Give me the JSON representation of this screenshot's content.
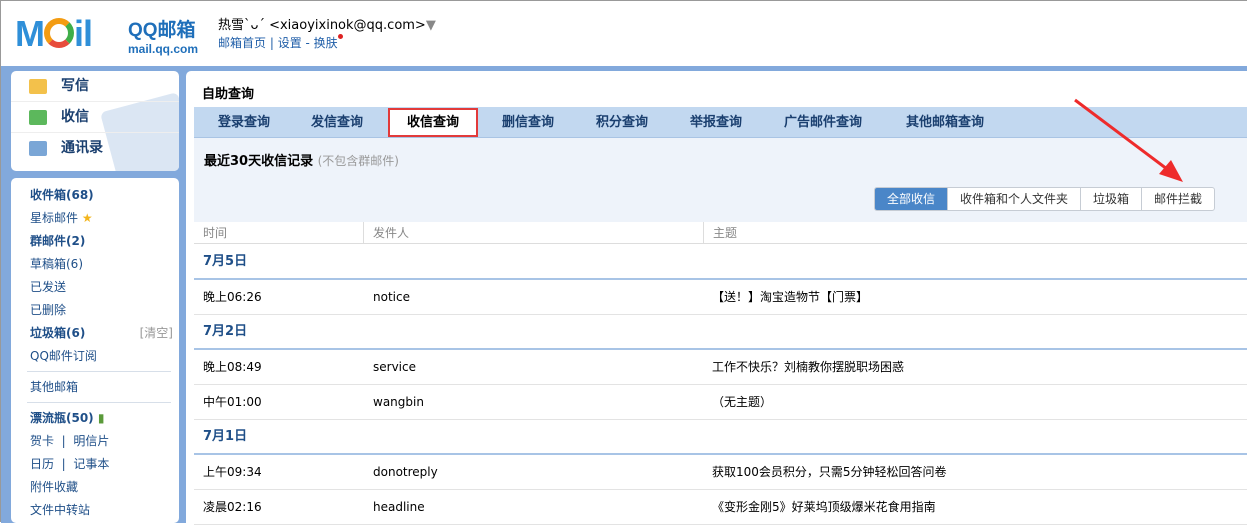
{
  "header": {
    "logo": "MOil",
    "brand": "QQ邮箱",
    "brand_url": "mail.qq.com",
    "user": "热雪`ᴗ´ <xiaoyixinok@qq.com>",
    "links": [
      "邮箱首页",
      "设置",
      "换肤"
    ]
  },
  "compose": [
    "写信",
    "收信",
    "通讯录"
  ],
  "folders": {
    "inbox": "收件箱(68)",
    "starred": "星标邮件",
    "group": "群邮件(2)",
    "drafts": "草稿箱(6)",
    "sent": "已发送",
    "deleted": "已删除",
    "spam": "垃圾箱(6)",
    "clear": "[清空]",
    "subscribe": "QQ邮件订阅",
    "other": "其他邮箱",
    "bottle": "漂流瓶(50)",
    "card": "贺卡",
    "postcard": "明信片",
    "calendar": "日历",
    "notes": "记事本",
    "attach": "附件收藏",
    "transfer": "文件中转站"
  },
  "main": {
    "title": "自助查询",
    "tabs": [
      "登录查询",
      "发信查询",
      "收信查询",
      "删信查询",
      "积分查询",
      "举报查询",
      "广告邮件查询",
      "其他邮箱查询"
    ],
    "active_tab": "收信查询",
    "subtitle": "最近30天收信记录",
    "subnote": "(不包含群邮件)",
    "filters": [
      "全部收信",
      "收件箱和个人文件夹",
      "垃圾箱",
      "邮件拦截"
    ],
    "columns": [
      "时间",
      "发件人",
      "主题"
    ],
    "groups": [
      {
        "date": "7月5日",
        "rows": [
          {
            "time": "晚上06:26",
            "from": "notice",
            "subject": "【送！】淘宝造物节【门票】"
          }
        ]
      },
      {
        "date": "7月2日",
        "rows": [
          {
            "time": "晚上08:49",
            "from": "service",
            "subject": "工作不快乐？刘楠教你摆脱职场困惑"
          },
          {
            "time": "中午01:00",
            "from": "wangbin",
            "subject": "（无主题）"
          }
        ]
      },
      {
        "date": "7月1日",
        "rows": [
          {
            "time": "上午09:34",
            "from": "donotreply",
            "subject": "获取100会员积分，只需5分钟轻松回答问卷"
          },
          {
            "time": "凌晨02:16",
            "from": "headline",
            "subject": "《变形金刚5》好莱坞顶级爆米花食用指南"
          }
        ]
      }
    ]
  }
}
